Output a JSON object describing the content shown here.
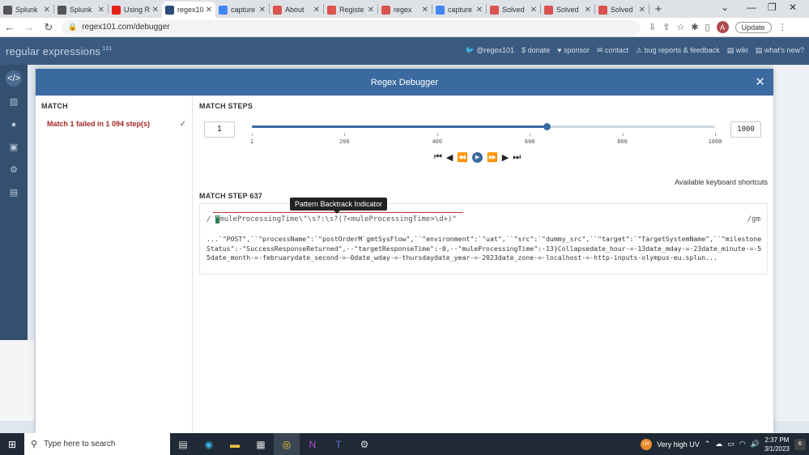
{
  "browser": {
    "tabs": [
      {
        "label": "Splunk",
        "color": "#555"
      },
      {
        "label": "Splunk",
        "color": "#555"
      },
      {
        "label": "Using R",
        "color": "#e62117"
      },
      {
        "label": "regex101",
        "color": "#2b4a78",
        "active": true
      },
      {
        "label": "capture",
        "color": "#4285f4"
      },
      {
        "label": "About",
        "color": "#d9534f"
      },
      {
        "label": "Registe",
        "color": "#d9534f"
      },
      {
        "label": "regex",
        "color": "#d9534f"
      },
      {
        "label": "capture",
        "color": "#4285f4"
      },
      {
        "label": "Solved",
        "color": "#d9534f"
      },
      {
        "label": "Solved",
        "color": "#d9534f"
      },
      {
        "label": "Solved",
        "color": "#d9534f"
      }
    ],
    "url": "regex101.com/debugger",
    "profile_initial": "A",
    "update_label": "Update"
  },
  "site": {
    "brand": "regular expressions",
    "brand_sup": "101",
    "nav": [
      "@regex101",
      "donate",
      "sponsor",
      "contact",
      "bug reports & feedback",
      "wiki",
      "what's new?"
    ]
  },
  "modal": {
    "title": "Regex Debugger",
    "match_title": "MATCH",
    "match_item": "Match 1 failed in 1 094 step(s)",
    "steps_title": "MATCH STEPS",
    "step_current": "1",
    "step_max": "1000",
    "slider_fraction": 0.637,
    "tick_labels": [
      "1",
      "200",
      "400",
      "600",
      "800",
      "1000"
    ],
    "keyboard_link": "Available keyboard shortcuts",
    "step_title": "MATCH STEP 637",
    "tooltip": "Pattern Backtrack Indicator",
    "pattern_open": "/",
    "pattern_hl": "\"",
    "pattern_rest": "muleProcessingTime\\\"\\s?:\\s?(?<muleProcessingTime>\\d+)\"",
    "pattern_flags": "/gm",
    "test_string": "...`\"POST\",``\"processName\":`\"postOrderM`gmtSysFlow\",``\"environment\":`\"uat\",``\"src\":`\"dummy_src\",``\"target\":`\"TargetSystemName\",``\"milestoneStatus\":·\"SuccessResponseReturned\",··\"targetResponseTime\":·0,··\"muleProcessingTime\":·13}Collapsedate_hour·=·13date_mday·=·23date_minute·=·55date_month·=·februarydate_second·=·0date_wday·=·thursdaydate_year·=·2023date_zone·=·localhost·=·http-inputs-olympus-eu.splun..."
  },
  "taskbar": {
    "search_placeholder": "Type here to search",
    "weather": "Very high UV",
    "weather_badge": "UV",
    "time": "2:37 PM",
    "date": "3/1/2023",
    "notifications": "6"
  }
}
